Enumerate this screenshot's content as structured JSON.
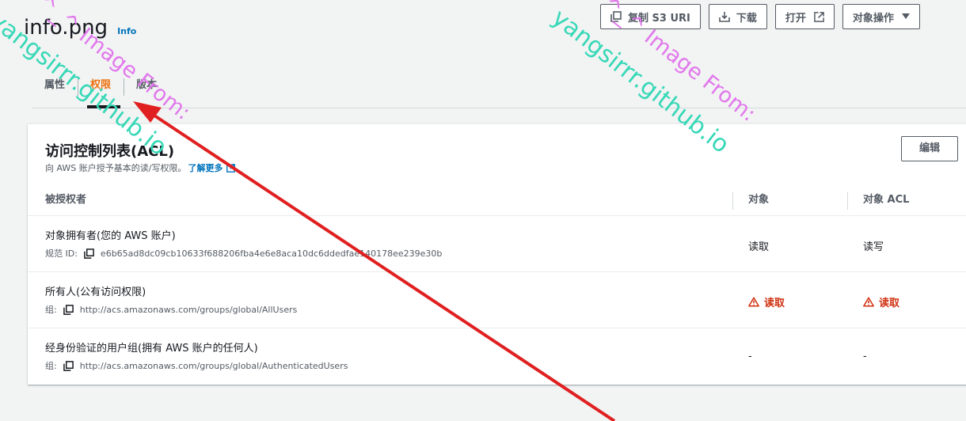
{
  "header": {
    "title": "info.png",
    "info_link": "Info",
    "buttons": {
      "copy_s3_uri": "复制 S3 URI",
      "download": "下载",
      "open": "打开",
      "object_actions": "对象操作"
    }
  },
  "tabs": [
    {
      "label": "属性"
    },
    {
      "label": "权限"
    },
    {
      "label": "版本"
    }
  ],
  "acl_panel": {
    "title": "访问控制列表(ACL)",
    "description": "向 AWS 账户授予基本的读/写权限。",
    "learn_more": "了解更多",
    "edit_button": "编辑",
    "columns": [
      "被授权者",
      "对象",
      "对象 ACL"
    ],
    "rows": [
      {
        "grantee": "对象拥有者(您的 AWS 账户)",
        "meta_label": "规范 ID:",
        "meta_value": "e6b65ad8dc09cb10633f688206fba4e6e8aca10dc6ddedfae140178ee239e30b",
        "object": "读取",
        "object_acl": "读写",
        "warning": false
      },
      {
        "grantee": "所有人(公有访问权限)",
        "meta_label": "组:",
        "meta_value": "http://acs.amazonaws.com/groups/global/AllUsers",
        "object": "读取",
        "object_acl": "读取",
        "warning": true
      },
      {
        "grantee": "经身份验证的用户组(拥有 AWS 账户的任何人)",
        "meta_label": "组:",
        "meta_value": "http://acs.amazonaws.com/groups/global/AuthenticatedUsers",
        "object": "-",
        "object_acl": "-",
        "warning": false
      }
    ]
  },
  "watermarks": [
    {
      "line1": "^_^ Image From:",
      "line2": "yangsirrr.github.io"
    },
    {
      "line1": "^_^ Image From:",
      "line2": "yangsirrr.github.io"
    }
  ],
  "colors": {
    "accent": "#ec7211",
    "link": "#0073bb",
    "warning": "#d13212",
    "annotation_arrow": "#e02020"
  }
}
